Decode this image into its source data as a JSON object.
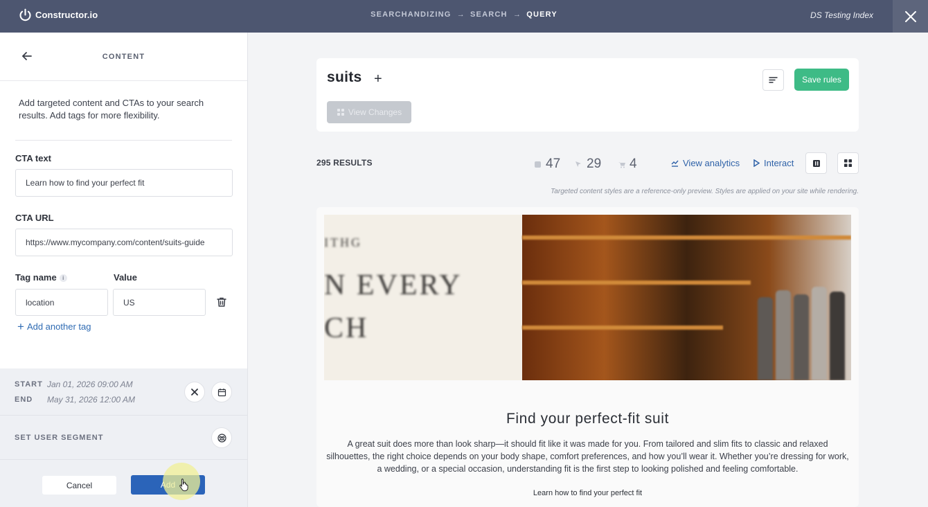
{
  "header": {
    "logo_text": "Constructor.io",
    "breadcrumb": [
      "SEARCHANDIZING",
      "SEARCH",
      "QUERY"
    ],
    "breadcrumb_arrow": "→",
    "index_name": "DS Testing Index"
  },
  "left_panel": {
    "title": "CONTENT",
    "description": "Add targeted content and CTAs to your search results. Add tags for more flexibility.",
    "cta_text_label": "CTA text",
    "cta_text_value": "Learn how to find your perfect fit",
    "cta_url_label": "CTA URL",
    "cta_url_value": "https://www.mycompany.com/content/suits-guide",
    "tag_name_label": "Tag name",
    "tag_value_label": "Value",
    "tag_name_value": "location",
    "tag_value_value": "US",
    "add_tag_label": "Add another tag",
    "start_label": "START",
    "start_value": "Jan 01, 2026 09:00 AM",
    "end_label": "END",
    "end_value": "May 31, 2026 12:00 AM",
    "segment_label": "SET USER SEGMENT",
    "cancel_label": "Cancel",
    "add_label": "Add"
  },
  "query": {
    "term": "suits",
    "view_changes_label": "View Changes",
    "save_label": "Save rules"
  },
  "results": {
    "count_label": "295 RESULTS",
    "stat_1": "47",
    "stat_2": "29",
    "stat_3": "4",
    "view_analytics_label": "View analytics",
    "interact_label": "Interact",
    "preview_note": "Targeted content styles are a reference-only preview. Styles are applied on your site while rendering."
  },
  "content_preview": {
    "banner_text_1": "ITHG",
    "banner_text_2": "N EVERY",
    "banner_text_3": "CH",
    "title": "Find your perfect-fit suit",
    "body": "A great suit does more than look sharp—it should fit like it was made for you. From tailored and slim fits to classic and relaxed silhouettes, the right choice depends on your body shape, comfort preferences, and how you’ll wear it. Whether you’re dressing for work, a wedding, or a special occasion, understanding fit is the first step to looking polished and feeling comfortable.",
    "cta_link": "Learn how to find your perfect fit"
  },
  "colors": {
    "topbar": "#4d5670",
    "primary_button": "#2b64b9",
    "save_button": "#3ebb86",
    "link": "#2f62a8"
  }
}
